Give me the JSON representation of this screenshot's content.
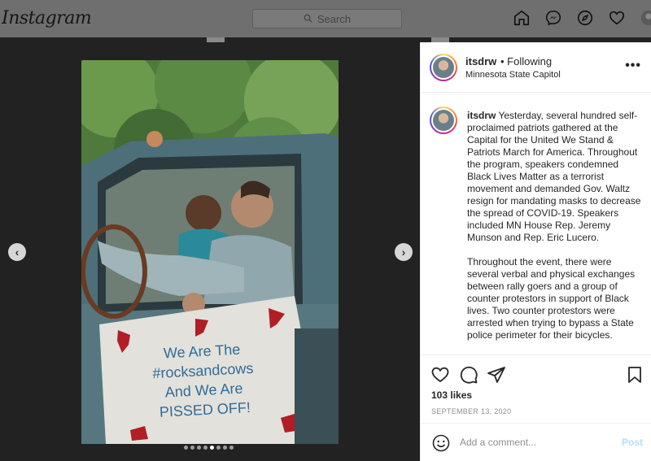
{
  "app": {
    "logo_text": "Instagram"
  },
  "search": {
    "placeholder": "Search"
  },
  "nav": {
    "icons": [
      "home-icon",
      "messenger-icon",
      "explore-icon",
      "heart-icon",
      "profile-avatar"
    ]
  },
  "post": {
    "username": "itsdrw",
    "follow_status": "• Following",
    "location": "Minnesota State Capitol",
    "caption_user": "itsdrw",
    "caption_p1": "Yesterday, several hundred self-proclaimed patriots gathered at the Capital for the United We Stand & Patriots March for America. Throughout the program, speakers condemned Black Lives Matter as a terrorist movement and demanded Gov. Waltz resign for mandating masks to decrease the spread of COVID-19. Speakers included MN House Rep. Jeremy Munson and Rep. Eric Lucero.",
    "caption_p2": "Throughout the event, there were several verbal and physical exchanges between rally goers and a group of counter protestors in support of Black lives. Two counter protestors were arrested when trying to bypass a State police perimeter for their bicycles.",
    "likes": "103 likes",
    "date": "SEPTEMBER 13, 2020",
    "sign_lines": [
      "We Are The",
      "#rocksandcows",
      "And We Are",
      "PISSED OFF!"
    ],
    "carousel": {
      "count": 8,
      "active_index": 4
    }
  },
  "comment_box": {
    "placeholder": "Add a comment...",
    "post_label": "Post"
  },
  "colors": {
    "accent": "#0095f6",
    "post_disabled": "#b2dffc",
    "text": "#262626",
    "muted": "#8e8e8e"
  }
}
